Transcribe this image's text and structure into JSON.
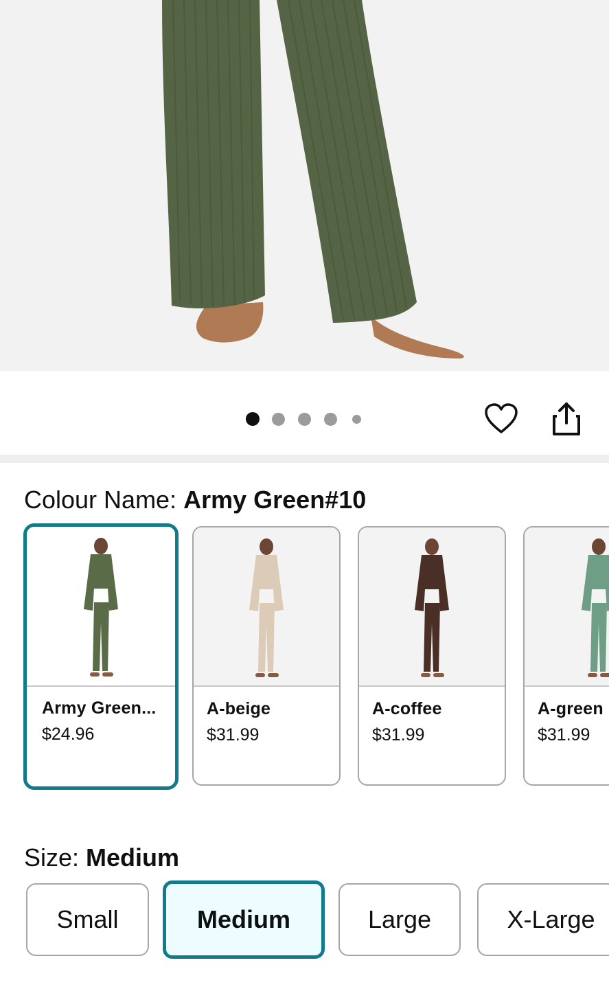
{
  "gallery": {
    "total_images": 5,
    "active_index": 0
  },
  "actions": {
    "wishlist_icon": "heart-icon",
    "share_icon": "share-icon"
  },
  "colour": {
    "label": "Colour Name: ",
    "selected": "Army Green#10",
    "options": [
      {
        "name": "Army Green...",
        "price": "$24.96",
        "color": "#5a6b48",
        "selected": true
      },
      {
        "name": "A-beige",
        "price": "$31.99",
        "color": "#dccbb6",
        "selected": false
      },
      {
        "name": "A-coffee",
        "price": "$31.99",
        "color": "#4a2f26",
        "selected": false
      },
      {
        "name": "A-green",
        "price": "$31.99",
        "color": "#6f9e86",
        "selected": false
      }
    ]
  },
  "size": {
    "label": "Size: ",
    "selected": "Medium",
    "options": [
      {
        "label": "Small",
        "selected": false
      },
      {
        "label": "Medium",
        "selected": true
      },
      {
        "label": "Large",
        "selected": false
      },
      {
        "label": "X-Large",
        "selected": false
      }
    ]
  },
  "colors": {
    "accent": "#117a8b",
    "selected_bg": "#edfdff",
    "pants": "#566446"
  }
}
